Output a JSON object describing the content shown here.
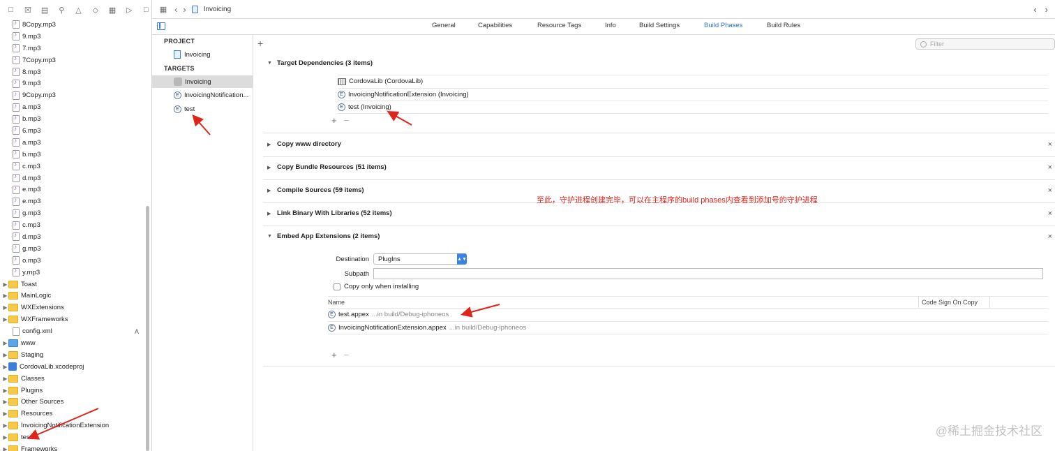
{
  "navigator": {
    "items": [
      {
        "label": "8Copy.mp3",
        "kind": "audio"
      },
      {
        "label": "9.mp3",
        "kind": "audio"
      },
      {
        "label": "7.mp3",
        "kind": "audio"
      },
      {
        "label": "7Copy.mp3",
        "kind": "audio"
      },
      {
        "label": "8.mp3",
        "kind": "audio"
      },
      {
        "label": "9.mp3",
        "kind": "audio"
      },
      {
        "label": "9Copy.mp3",
        "kind": "audio"
      },
      {
        "label": "a.mp3",
        "kind": "audio"
      },
      {
        "label": "b.mp3",
        "kind": "audio"
      },
      {
        "label": "6.mp3",
        "kind": "audio"
      },
      {
        "label": "a.mp3",
        "kind": "audio"
      },
      {
        "label": "b.mp3",
        "kind": "audio"
      },
      {
        "label": "c.mp3",
        "kind": "audio"
      },
      {
        "label": "d.mp3",
        "kind": "audio"
      },
      {
        "label": "e.mp3",
        "kind": "audio"
      },
      {
        "label": "e.mp3",
        "kind": "audio"
      },
      {
        "label": "g.mp3",
        "kind": "audio"
      },
      {
        "label": "c.mp3",
        "kind": "audio"
      },
      {
        "label": "d.mp3",
        "kind": "audio"
      },
      {
        "label": "g.mp3",
        "kind": "audio"
      },
      {
        "label": "o.mp3",
        "kind": "audio"
      },
      {
        "label": "y.mp3",
        "kind": "audio"
      },
      {
        "label": "Toast",
        "kind": "folder"
      },
      {
        "label": "MainLogic",
        "kind": "folder"
      },
      {
        "label": "WXExtensions",
        "kind": "folder"
      },
      {
        "label": "WXFrameworks",
        "kind": "folder"
      },
      {
        "label": "config.xml",
        "kind": "file",
        "badge": "A"
      },
      {
        "label": "www",
        "kind": "folder-blue"
      },
      {
        "label": "Staging",
        "kind": "folder"
      },
      {
        "label": "CordovaLib.xcodeproj",
        "kind": "project"
      },
      {
        "label": "Classes",
        "kind": "folder"
      },
      {
        "label": "Plugins",
        "kind": "folder"
      },
      {
        "label": "Other Sources",
        "kind": "folder"
      },
      {
        "label": "Resources",
        "kind": "folder"
      },
      {
        "label": "InvoicingNotificationExtension",
        "kind": "folder"
      },
      {
        "label": "test",
        "kind": "folder"
      },
      {
        "label": "Frameworks",
        "kind": "folder"
      }
    ]
  },
  "topbar": {
    "breadcrumb": "Invoicing"
  },
  "tabs": [
    "General",
    "Capabilities",
    "Resource Tags",
    "Info",
    "Build Settings",
    "Build Phases",
    "Build Rules"
  ],
  "active_tab": "Build Phases",
  "targets_panel": {
    "project_header": "PROJECT",
    "project_item": "Invoicing",
    "targets_header": "TARGETS",
    "targets": [
      "Invoicing",
      "InvoicingNotification...",
      "test"
    ]
  },
  "filter": {
    "placeholder": "Filter"
  },
  "phases": {
    "target_dependencies": {
      "title": "Target Dependencies (3 items)",
      "items": [
        "CordovaLib (CordovaLib)",
        "InvoicingNotificationExtension (Invoicing)",
        "test (Invoicing)"
      ]
    },
    "copy_www": {
      "title": "Copy www directory"
    },
    "copy_bundle": {
      "title": "Copy Bundle Resources (51 items)"
    },
    "compile_sources": {
      "title": "Compile Sources (59 items)"
    },
    "link_binary": {
      "title": "Link Binary With Libraries (52 items)"
    },
    "embed_app_ext": {
      "title": "Embed App Extensions (2 items)",
      "destination_label": "Destination",
      "destination_value": "PlugIns",
      "subpath_label": "Subpath",
      "subpath_value": "",
      "copy_only_label": "Copy only when installing",
      "col_name": "Name",
      "col_code_sign": "Code Sign On Copy",
      "rows": [
        {
          "name": "test.appex",
          "path": "...in build/Debug-iphoneos"
        },
        {
          "name": "InvoicingNotificationExtension.appex",
          "path": "...in build/Debug-iphoneos"
        }
      ]
    }
  },
  "glyphs": {
    "plus": "+",
    "minus": "−",
    "close": "×",
    "back": "‹",
    "forward": "›",
    "ext": "E"
  },
  "annotation": "至此，守护进程创建完毕，可以在主程序的build phases内查看到添加号的守护进程",
  "watermark": "@稀土掘金技术社区",
  "colors": {
    "accent": "#2f73d8",
    "annotation": "#e0241b",
    "folder": "#f7c948"
  }
}
